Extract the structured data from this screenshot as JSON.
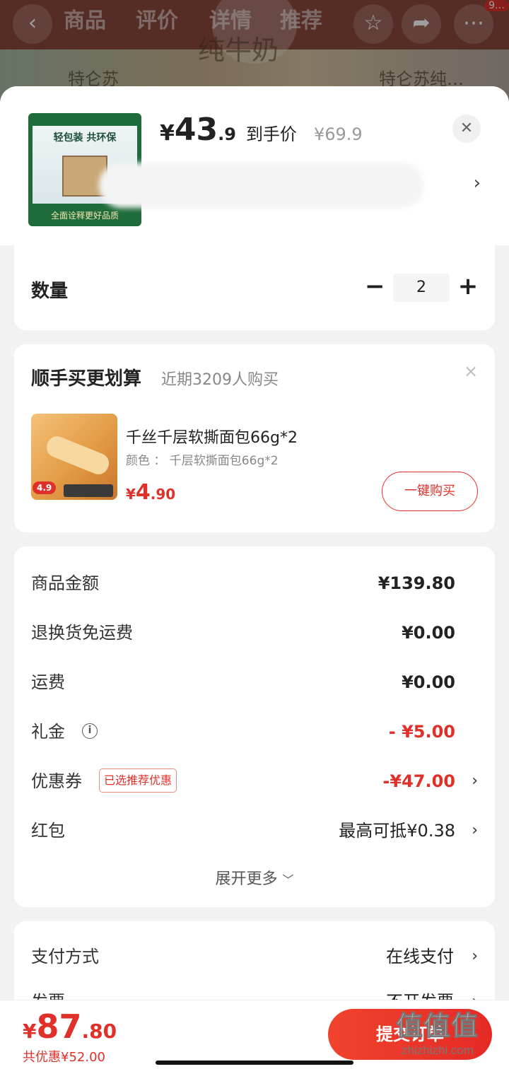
{
  "background": {
    "nav_tabs": [
      "商品",
      "评价",
      "详情",
      "推荐"
    ],
    "side_label": "纯牛奶",
    "bg_title_left": "特仑苏",
    "bg_title_right": "特仑苏纯…",
    "badge": "9…"
  },
  "product": {
    "thumb_headline": "轻包装 共环保",
    "thumb_footer": "全面诠释更好品质",
    "price_currency": "¥",
    "price_integer": "43",
    "price_decimal": ".9",
    "price_tag": "到手价",
    "original_price": "¥69.9"
  },
  "quantity": {
    "label": "数量",
    "minus": "−",
    "value": "2",
    "plus": "+"
  },
  "upsell": {
    "title": "顺手买更划算",
    "subtitle": "近期3209人购买",
    "close": "×",
    "item_name": "千丝千层软撕面包66g*2",
    "item_spec": "颜色 ： 千层软撕面包66g*2",
    "image_price_label": "4.9",
    "price_currency": "¥",
    "price_integer": "4",
    "price_decimal": ".90",
    "buy_label": "一键购买"
  },
  "summary": {
    "rows": [
      {
        "label": "商品金额",
        "value": "¥139.80"
      },
      {
        "label": "退换货免运费",
        "value": "¥0.00"
      },
      {
        "label": "运费",
        "value": "¥0.00"
      },
      {
        "label": "礼金",
        "value": "- ¥5.00"
      },
      {
        "label": "优惠券",
        "tag": "已选推荐优惠",
        "value": "-¥47.00"
      },
      {
        "label": "红包",
        "value": "最高可抵¥0.38"
      }
    ],
    "expand_label": "展开更多",
    "info_glyph": "i"
  },
  "payment": {
    "method_label": "支付方式",
    "method_value": "在线支付",
    "invoice_label": "发票",
    "invoice_value": "不开发票"
  },
  "footer": {
    "total_currency": "¥",
    "total_integer": "87",
    "total_decimal": ".80",
    "saving": "共优惠¥52.00",
    "submit_label": "提交订单"
  },
  "watermark": {
    "main": "值值值",
    "sub": "zhizhizhi.com"
  },
  "colors": {
    "accent_red": "#e0302a",
    "sheet_bg": "#f2f2f2",
    "card_bg": "#ffffff"
  },
  "icons": {
    "close": "close-icon",
    "chevron": "chevron-right-icon",
    "info": "info-icon",
    "expand": "chevron-down-icon"
  }
}
